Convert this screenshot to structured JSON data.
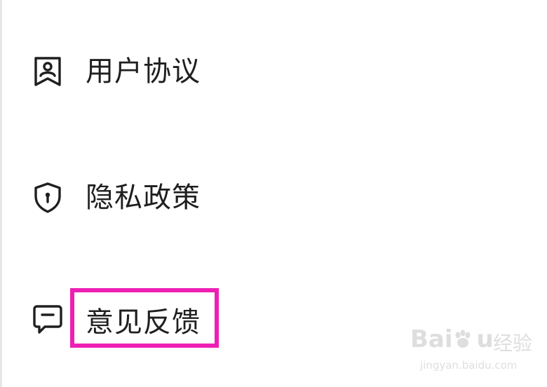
{
  "menu": {
    "items": [
      {
        "label": "用户协议",
        "icon": "bookmark-user-icon"
      },
      {
        "label": "隐私政策",
        "icon": "shield-lock-icon"
      },
      {
        "label": "意见反馈",
        "icon": "chat-bubble-icon"
      }
    ]
  },
  "highlight": {
    "color": "#ee1fb4",
    "target": "意见反馈"
  },
  "watermark": {
    "brand": "Bai",
    "brand_suffix": "u",
    "cn": "经验",
    "url": "jingyan.baidu.com"
  }
}
